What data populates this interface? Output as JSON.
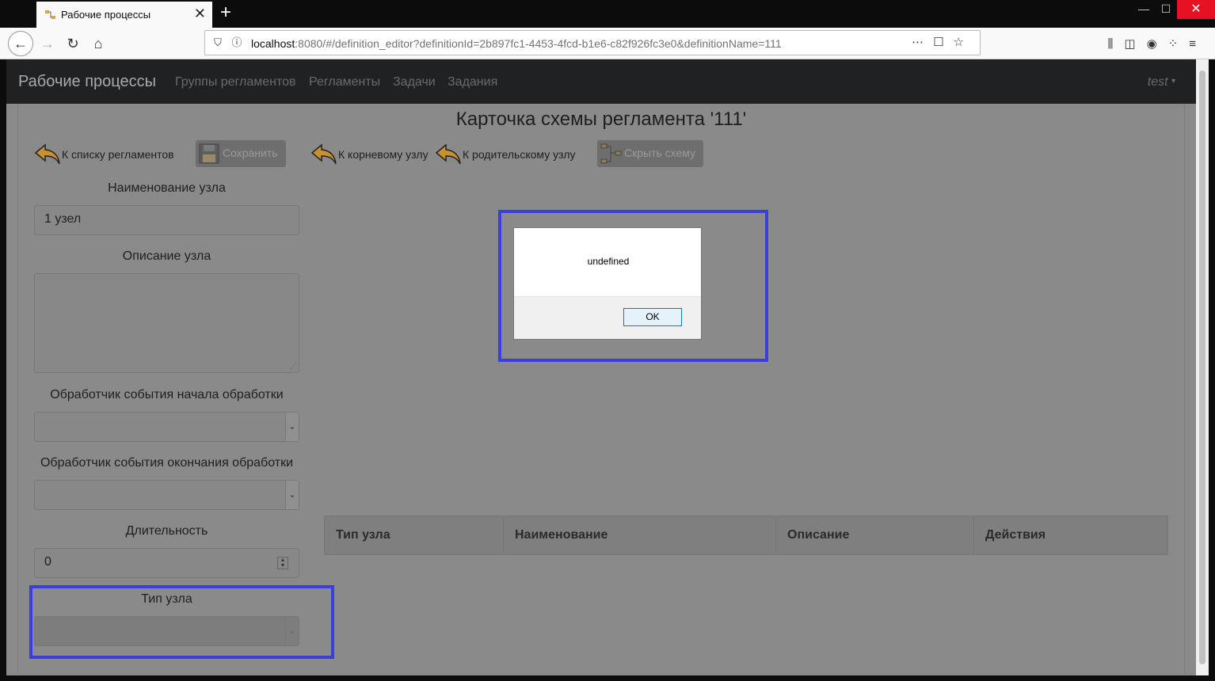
{
  "browser": {
    "tab_title": "Рабочие процессы",
    "url_host": "localhost",
    "url_rest": ":8080/#/definition_editor?definitionId=2b897fc1-4453-4fcd-b1e6-c82f926fc3e0&definitionName=111"
  },
  "app": {
    "brand": "Рабочие процессы",
    "nav": [
      "Группы регламентов",
      "Регламенты",
      "Задачи",
      "Задания"
    ],
    "user": "test"
  },
  "page": {
    "title": "Карточка схемы регламента '111'",
    "toolbar": {
      "back_to_list": "К списку регламентов",
      "save": "Сохранить",
      "to_root": "К корневому узлу",
      "to_parent": "К родительскому узлу",
      "hide_scheme": "Скрыть схему"
    },
    "form": {
      "name_label": "Наименование узла",
      "name_value": "1 узел",
      "desc_label": "Описание узла",
      "desc_value": "",
      "start_handler_label": "Обработчик события начала обработки",
      "start_handler_value": "",
      "end_handler_label": "Обработчик события окончания обработки",
      "end_handler_value": "",
      "duration_label": "Длительность",
      "duration_value": "0",
      "type_label": "Тип узла",
      "type_value": ""
    },
    "table": {
      "headers": [
        "Тип узла",
        "Наименование",
        "Описание",
        "Действия"
      ]
    }
  },
  "dialog": {
    "message": "undefined",
    "ok_label": "OK"
  },
  "colors": {
    "highlight": "#3a3fd9",
    "close_button": "#e81123"
  }
}
